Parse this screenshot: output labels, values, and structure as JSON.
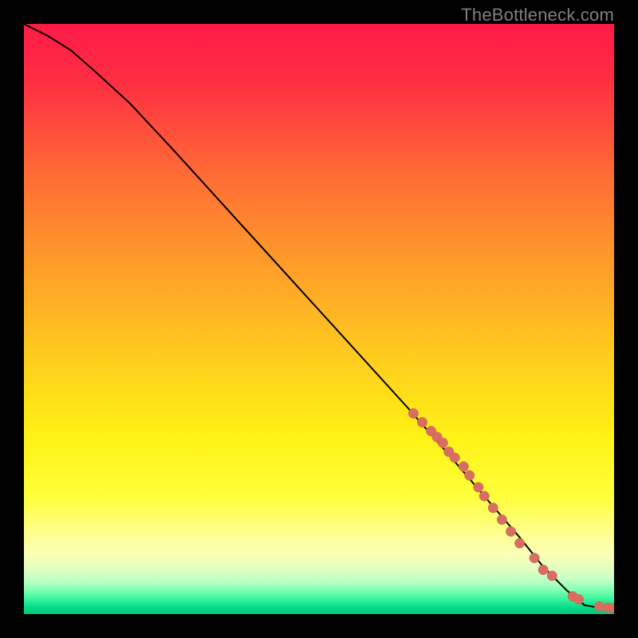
{
  "watermark": "TheBottleneck.com",
  "colors": {
    "background_black": "#000000",
    "line": "#000000",
    "marker_fill": "#d86e62",
    "marker_stroke": "#c75b52",
    "watermark_text": "#808080"
  },
  "chart_data": {
    "type": "line",
    "title": "",
    "xlabel": "",
    "ylabel": "",
    "xlim": [
      0,
      100
    ],
    "ylim": [
      0,
      100
    ],
    "gradient_stops": [
      {
        "offset": 0.0,
        "color": "#ff1a47"
      },
      {
        "offset": 0.1,
        "color": "#ff2f42"
      },
      {
        "offset": 0.25,
        "color": "#ff6a36"
      },
      {
        "offset": 0.4,
        "color": "#ff9a2a"
      },
      {
        "offset": 0.55,
        "color": "#ffc81e"
      },
      {
        "offset": 0.7,
        "color": "#fff215"
      },
      {
        "offset": 0.8,
        "color": "#ffff3a"
      },
      {
        "offset": 0.86,
        "color": "#ffff8a"
      },
      {
        "offset": 0.9,
        "color": "#faffb8"
      },
      {
        "offset": 0.925,
        "color": "#dfffc2"
      },
      {
        "offset": 0.945,
        "color": "#b8ffc2"
      },
      {
        "offset": 0.96,
        "color": "#7dffb2"
      },
      {
        "offset": 0.975,
        "color": "#37f49d"
      },
      {
        "offset": 0.99,
        "color": "#00d985"
      },
      {
        "offset": 1.0,
        "color": "#00c878"
      }
    ],
    "series": [
      {
        "name": "curve",
        "x": [
          0,
          4,
          8,
          12,
          18,
          25,
          35,
          45,
          55,
          65,
          72,
          78,
          84,
          88,
          90,
          92,
          95,
          98,
          100
        ],
        "y": [
          100,
          98,
          95.5,
          92,
          86.5,
          79,
          68,
          57,
          46,
          35,
          27,
          20,
          13,
          8,
          6,
          4,
          1.5,
          1,
          1
        ]
      }
    ],
    "markers": {
      "name": "points",
      "x": [
        66,
        67.5,
        69,
        70,
        71,
        72,
        73,
        74.5,
        75.5,
        77,
        78,
        79.5,
        81,
        82.5,
        84,
        86.5,
        88,
        89.5,
        93,
        94,
        97.5,
        99,
        100
      ],
      "y": [
        34,
        32.5,
        31,
        30,
        29,
        27.5,
        26.5,
        25,
        23.5,
        21.5,
        20,
        18,
        16,
        14,
        12,
        9.5,
        7.5,
        6.5,
        3,
        2.5,
        1.3,
        1.1,
        1.0
      ],
      "radius_px": 6.2
    }
  }
}
